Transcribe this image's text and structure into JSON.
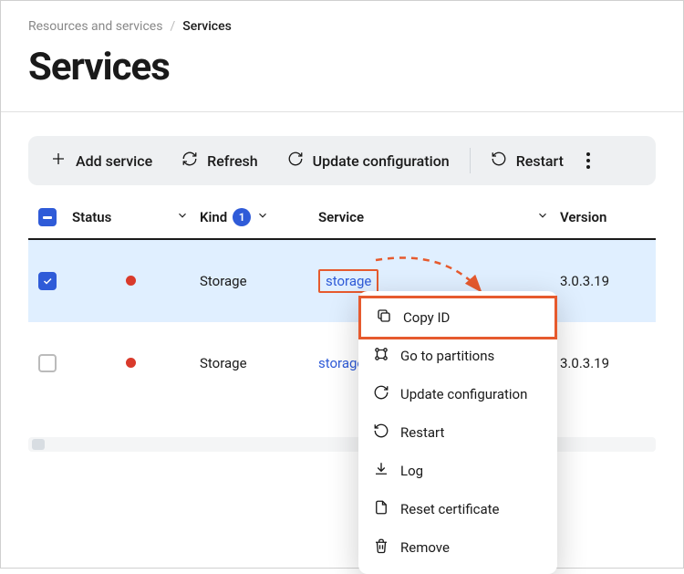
{
  "breadcrumb": {
    "root": "Resources and services",
    "current": "Services"
  },
  "page_title": "Services",
  "toolbar": {
    "add_service": "Add service",
    "refresh": "Refresh",
    "update_config": "Update configuration",
    "restart": "Restart"
  },
  "columns": {
    "status": "Status",
    "kind": "Kind",
    "kind_filter_count": "1",
    "service": "Service",
    "version": "Version"
  },
  "rows": [
    {
      "selected": true,
      "status_color": "#d93a2b",
      "kind": "Storage",
      "service": "storage",
      "version": "3.0.3.19",
      "highlight_service_link": true
    },
    {
      "selected": false,
      "status_color": "#d93a2b",
      "kind": "Storage",
      "service": "storage",
      "version": "3.0.3.19",
      "highlight_service_link": false
    }
  ],
  "context_menu": {
    "copy_id": "Copy ID",
    "go_partitions": "Go to partitions",
    "update_config": "Update configuration",
    "restart": "Restart",
    "log": "Log",
    "reset_cert": "Reset certificate",
    "remove": "Remove"
  },
  "annotation_colors": {
    "highlight": "#e65a2e"
  }
}
